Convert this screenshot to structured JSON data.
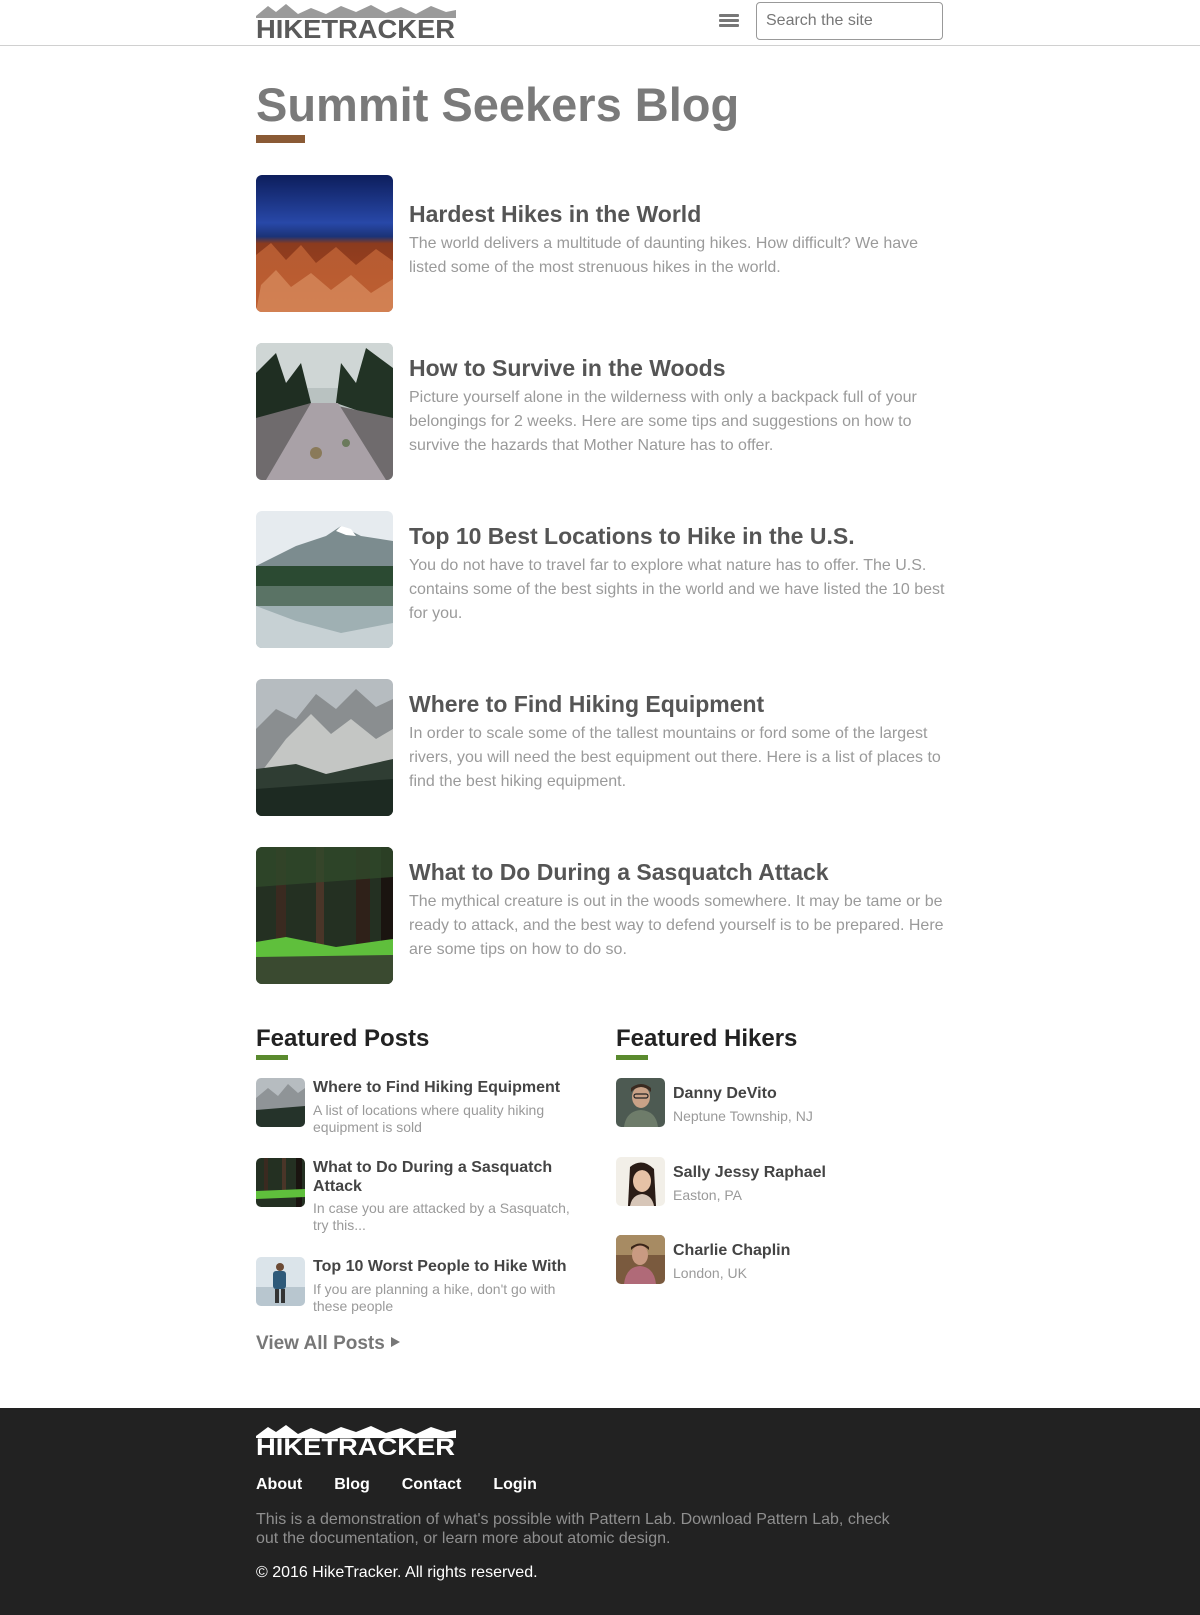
{
  "header": {
    "logo_text": "HIKETRACKER",
    "search_placeholder": "Search the site"
  },
  "page_title": "Summit Seekers Blog",
  "posts": [
    {
      "title": "Hardest Hikes in the World",
      "desc": "The world delivers a multitude of daunting hikes. How difficult? We have listed some of the most strenuous hikes in the world."
    },
    {
      "title": "How to Survive in the Woods",
      "desc": "Picture yourself alone in the wilderness with only a backpack full of your belongings for 2 weeks. Here are some tips and suggestions on how to survive the hazards that Mother Nature has to offer."
    },
    {
      "title": "Top 10 Best Locations to Hike in the U.S.",
      "desc": "You do not have to travel far to explore what nature has to offer. The U.S. contains some of the best sights in the world and we have listed the 10 best for you."
    },
    {
      "title": "Where to Find Hiking Equipment",
      "desc": "In order to scale some of the tallest mountains or ford some of the largest rivers, you will need the best equipment out there. Here is a list of places to find the best hiking equipment."
    },
    {
      "title": "What to Do During a Sasquatch Attack",
      "desc": "The mythical creature is out in the woods somewhere. It may be tame or be ready to attack, and the best way to defend yourself is to be prepared. Here are some tips on how to do so."
    }
  ],
  "featured_posts": {
    "title": "Featured Posts",
    "items": [
      {
        "title": "Where to Find Hiking Equipment",
        "desc": "A list of locations where quality hiking equipment is sold"
      },
      {
        "title": "What to Do During a Sasquatch Attack",
        "desc": "In case you are attacked by a Sasquatch, try this..."
      },
      {
        "title": "Top 10 Worst People to Hike With",
        "desc": "If you are planning a hike, don't go with these people"
      }
    ],
    "view_all": "View All Posts"
  },
  "featured_hikers": {
    "title": "Featured Hikers",
    "items": [
      {
        "name": "Danny DeVito",
        "location": "Neptune Township, NJ"
      },
      {
        "name": "Sally Jessy Raphael",
        "location": "Easton, PA"
      },
      {
        "name": "Charlie Chaplin",
        "location": "London, UK"
      }
    ]
  },
  "footer": {
    "nav": [
      "About",
      "Blog",
      "Contact",
      "Login"
    ],
    "description": "This is a demonstration of what's possible with Pattern Lab. Download Pattern Lab, check out the documentation, or learn more about atomic design.",
    "copyright": "© 2016 HikeTracker. All rights reserved."
  },
  "colors": {
    "title_accent": "#8a5a35",
    "section_accent": "#5a8a2e",
    "footer_bg": "#222222"
  }
}
